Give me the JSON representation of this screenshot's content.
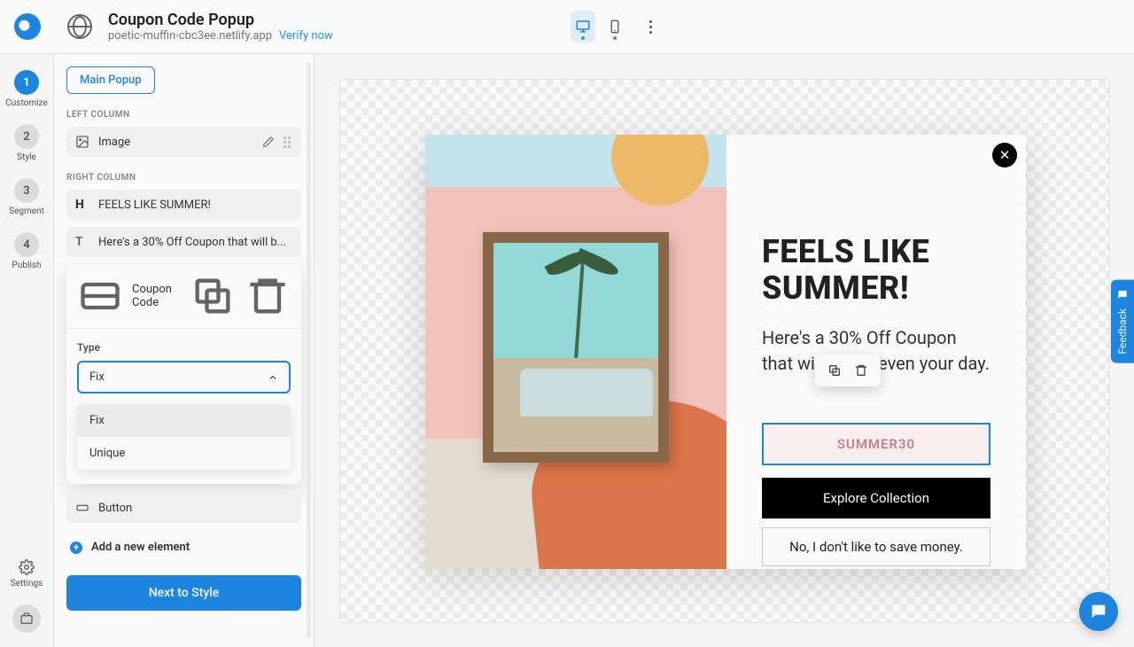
{
  "header": {
    "title": "Coupon Code Popup",
    "domain": "poetic-muffin-cbc3ee.netlify.app",
    "verify": "Verify now"
  },
  "rail": {
    "steps": [
      {
        "num": "1",
        "label": "Customize"
      },
      {
        "num": "2",
        "label": "Style"
      },
      {
        "num": "3",
        "label": "Segment"
      },
      {
        "num": "4",
        "label": "Publish"
      }
    ],
    "settings": "Settings"
  },
  "editor": {
    "main_popup": "Main Popup",
    "left_column": "LEFT COLUMN",
    "image_label": "Image",
    "right_column": "RIGHT COLUMN",
    "heading_label": "FEELS LIKE SUMMER!",
    "text_label": "Here's a 30% Off Coupon that will b...",
    "coupon_label": "Coupon Code",
    "type_label": "Type",
    "type_value": "Fix",
    "options": [
      "Fix",
      "Unique"
    ],
    "button_label": "Button",
    "add_element": "Add a new element",
    "next": "Next to Style"
  },
  "popup": {
    "headline": "FEELS LIKE SUMMER!",
    "subline": "Here's a 30% Off Coupon that will bright even your day.",
    "code": "SUMMER30",
    "cta": "Explore Collection",
    "decline": "No, I don't like to save money."
  },
  "feedback": "Feedback"
}
